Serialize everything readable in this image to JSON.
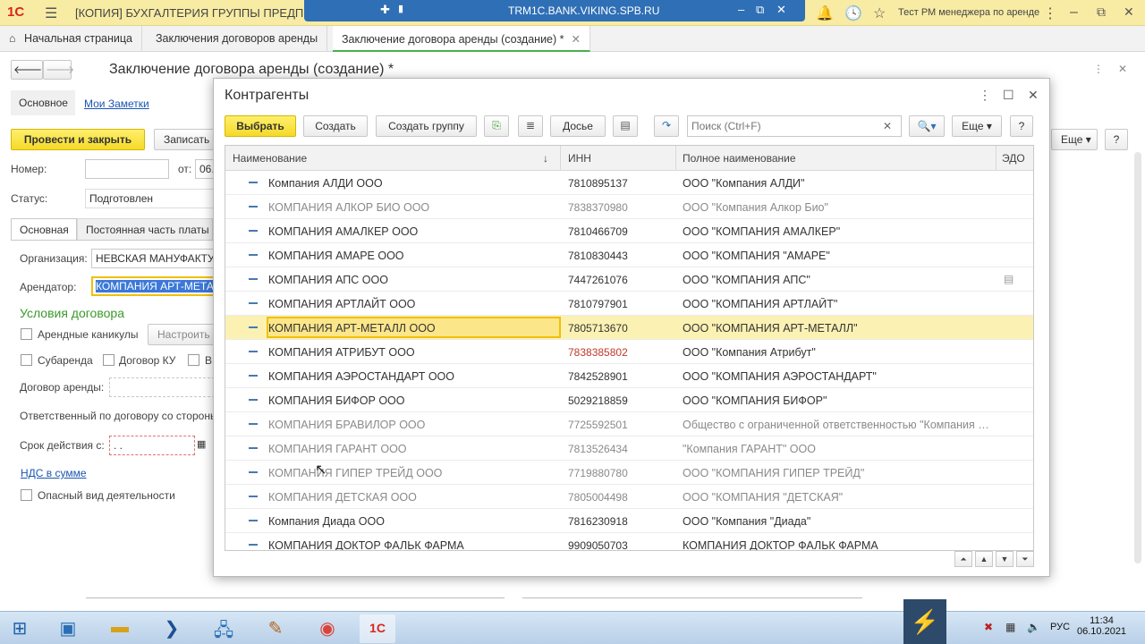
{
  "window": {
    "logo": "1С",
    "title": "[КОПИЯ] БУХГАЛТЕРИЯ ГРУППЫ ПРЕДПРИЯТИЙ 3",
    "rdp_host": "TRM1C.BANK.VIKING.SPB.RU",
    "user": "Тест РМ менеджера по аренде"
  },
  "tabs": [
    {
      "label": "Начальная страница"
    },
    {
      "label": "Заключения договоров аренды"
    },
    {
      "label": "Заключение договора аренды (создание) *"
    }
  ],
  "form": {
    "title": "Заключение договора аренды (создание) *",
    "nav_main": "Основное",
    "nav_notes": "Мои Заметки",
    "btn_post_close": "Провести и закрыть",
    "btn_save": "Записать",
    "btn_more": "Еще",
    "btn_help": "?",
    "number_label": "Номер:",
    "number_value": "",
    "date_label": "от:",
    "date_value": "06.",
    "status_label": "Статус:",
    "status_value": "Подготовлен",
    "subtab_main": "Основная",
    "subtab_fixed": "Постоянная часть платы",
    "org_label": "Организация:",
    "org_value": "НЕВСКАЯ МАНУФАКТУ",
    "tenant_label": "Арендатор:",
    "tenant_value": "КОМПАНИЯ АРТ-МЕТА",
    "section_conditions": "Условия договора",
    "cb_holidays": "Арендные каникулы",
    "btn_configure": "Настроить",
    "cb_sublease": "Субаренда",
    "cb_ku": "Договор КУ",
    "cb_v": "В",
    "lease_contract_label": "Договор аренды:",
    "responsible_label": "Ответственный по договору со стороны",
    "term_label": "Срок действия с:",
    "term_value": ". .",
    "vat_link": "НДС в сумме",
    "cb_hazard": "Опасный вид деятельности"
  },
  "dialog": {
    "title": "Контрагенты",
    "btn_select": "Выбрать",
    "btn_create": "Создать",
    "btn_create_group": "Создать группу",
    "btn_dossier": "Досье",
    "search_placeholder": "Поиск (Ctrl+F)",
    "btn_more": "Еще",
    "btn_help": "?",
    "columns": {
      "name": "Наименование",
      "sort": "↓",
      "inn": "ИНН",
      "full": "Полное наименование",
      "edo": "ЭДО"
    },
    "rows": [
      {
        "name": "Компания АЛДИ ООО",
        "inn": "7810895137",
        "full": "ООО \"Компания АЛДИ\"",
        "style": "normal"
      },
      {
        "name": "КОМПАНИЯ АЛКОР БИО ООО",
        "inn": "7838370980",
        "full": "ООО \"Компания Алкор Био\"",
        "style": "dim"
      },
      {
        "name": "КОМПАНИЯ АМАЛКЕР ООО",
        "inn": "7810466709",
        "full": "ООО \"КОМПАНИЯ АМАЛКЕР\"",
        "style": "normal"
      },
      {
        "name": "КОМПАНИЯ АМАРЕ ООО",
        "inn": "7810830443",
        "full": "ООО \"КОМПАНИЯ \"АМАРЕ\"",
        "style": "normal"
      },
      {
        "name": "КОМПАНИЯ АПС ООО",
        "inn": "7447261076",
        "full": "ООО \"КОМПАНИЯ АПС\"",
        "style": "normal"
      },
      {
        "name": "КОМПАНИЯ АРТЛАЙТ ООО",
        "inn": "7810797901",
        "full": "ООО \"КОМПАНИЯ АРТЛАЙТ\"",
        "style": "normal"
      },
      {
        "name": "КОМПАНИЯ АРТ-МЕТАЛЛ ООО",
        "inn": "7805713670",
        "full": "ООО \"КОМПАНИЯ АРТ-МЕТАЛЛ\"",
        "style": "selected"
      },
      {
        "name": "КОМПАНИЯ АТРИБУТ ООО",
        "inn": "7838385802",
        "full": "ООО \"Компания Атрибут\"",
        "style": "redinn"
      },
      {
        "name": "КОМПАНИЯ АЭРОСТАНДАРТ ООО",
        "inn": "7842528901",
        "full": "ООО \"КОМПАНИЯ АЭРОСТАНДАРТ\"",
        "style": "normal"
      },
      {
        "name": "КОМПАНИЯ БИФОР ООО",
        "inn": "5029218859",
        "full": "ООО \"КОМПАНИЯ БИФОР\"",
        "style": "normal"
      },
      {
        "name": "КОМПАНИЯ БРАВИЛОР ООО",
        "inn": "7725592501",
        "full": "Общество с ограниченной ответственностью \"Компания Б...",
        "style": "dim"
      },
      {
        "name": "КОМПАНИЯ ГАРАНТ ООО",
        "inn": "7813526434",
        "full": "\"Компания ГАРАНТ\" ООО",
        "style": "dim"
      },
      {
        "name": "КОМПАНИЯ ГИПЕР ТРЕЙД ООО",
        "inn": "7719880780",
        "full": "ООО \"КОМПАНИЯ ГИПЕР ТРЕЙД\"",
        "style": "dim"
      },
      {
        "name": "КОМПАНИЯ ДЕТСКАЯ ООО",
        "inn": "7805004498",
        "full": "ООО \"КОМПАНИЯ \"ДЕТСКАЯ\"",
        "style": "dim"
      },
      {
        "name": "Компания Диада ООО",
        "inn": "7816230918",
        "full": "ООО \"Компания \"Диада\"",
        "style": "normal"
      },
      {
        "name": "КОМПАНИЯ ДОКТОР ФАЛЬК ФАРМА",
        "inn": "9909050703",
        "full": "КОМПАНИЯ ДОКТОР ФАЛЬК ФАРМА",
        "style": "normal"
      }
    ]
  },
  "taskbar": {
    "lang": "РУС",
    "time": "11:34",
    "date": "06.10.2021"
  }
}
